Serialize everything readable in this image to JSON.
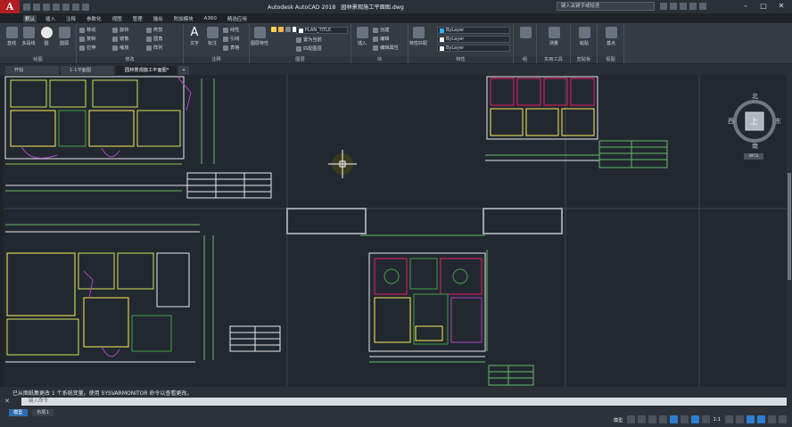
{
  "app": {
    "title": "Autodesk AutoCAD 2018",
    "file": "园林景观施工平面图.dwg",
    "search_placeholder": "键入关键字或短语",
    "user": "登录"
  },
  "ribbon_tabs": [
    "默认",
    "插入",
    "注释",
    "参数化",
    "视图",
    "管理",
    "输出",
    "附加模块",
    "A360",
    "精选应用"
  ],
  "ribbon": {
    "draw": {
      "title": "绘图",
      "line": "直线",
      "polyline": "多段线",
      "circle": "圆",
      "arc": "圆弧"
    },
    "modify": {
      "title": "修改",
      "move": "移动",
      "rotate": "旋转",
      "trim": "修剪",
      "copy": "复制",
      "mirror": "镜像",
      "fillet": "圆角",
      "stretch": "拉伸",
      "scale": "缩放",
      "array": "阵列"
    },
    "annotation": {
      "title": "注释",
      "text": "文字",
      "dimension": "标注",
      "linear": "线性",
      "leader": "引线",
      "table": "表格"
    },
    "layers": {
      "title": "图层",
      "layer_props": "图层特性",
      "current_layer": "PLAN_TITLE",
      "make_current": "置为当前",
      "match": "匹配图层"
    },
    "block": {
      "title": "块",
      "insert": "插入",
      "create": "创建",
      "edit": "编辑",
      "attrib": "编辑属性"
    },
    "properties": {
      "title": "特性",
      "match": "特性匹配",
      "color": "ByLayer",
      "linetype": "ByLayer",
      "lineweight": "ByLayer"
    },
    "groups": {
      "title": "组"
    },
    "utilities": {
      "title": "实用工具",
      "measure": "测量"
    },
    "clipboard": {
      "title": "剪贴板",
      "paste": "粘贴"
    },
    "view": {
      "title": "视图",
      "base": "基点"
    }
  },
  "doc_tabs": [
    "开始",
    "1-1平面图",
    "园林景观施工平面图*"
  ],
  "command": {
    "history": "已从图纸集更改 1 个系统变量。使用 SYSVARMONITOR 命令以查看更改。",
    "placeholder": "键入命令"
  },
  "layout_tabs": [
    "模型",
    "布局1"
  ],
  "status": {
    "model": "模型",
    "scale": "1:1"
  },
  "viewcube": {
    "north": "北",
    "south": "南",
    "east": "东",
    "west": "西",
    "top": "上",
    "wcs": "WCS"
  }
}
